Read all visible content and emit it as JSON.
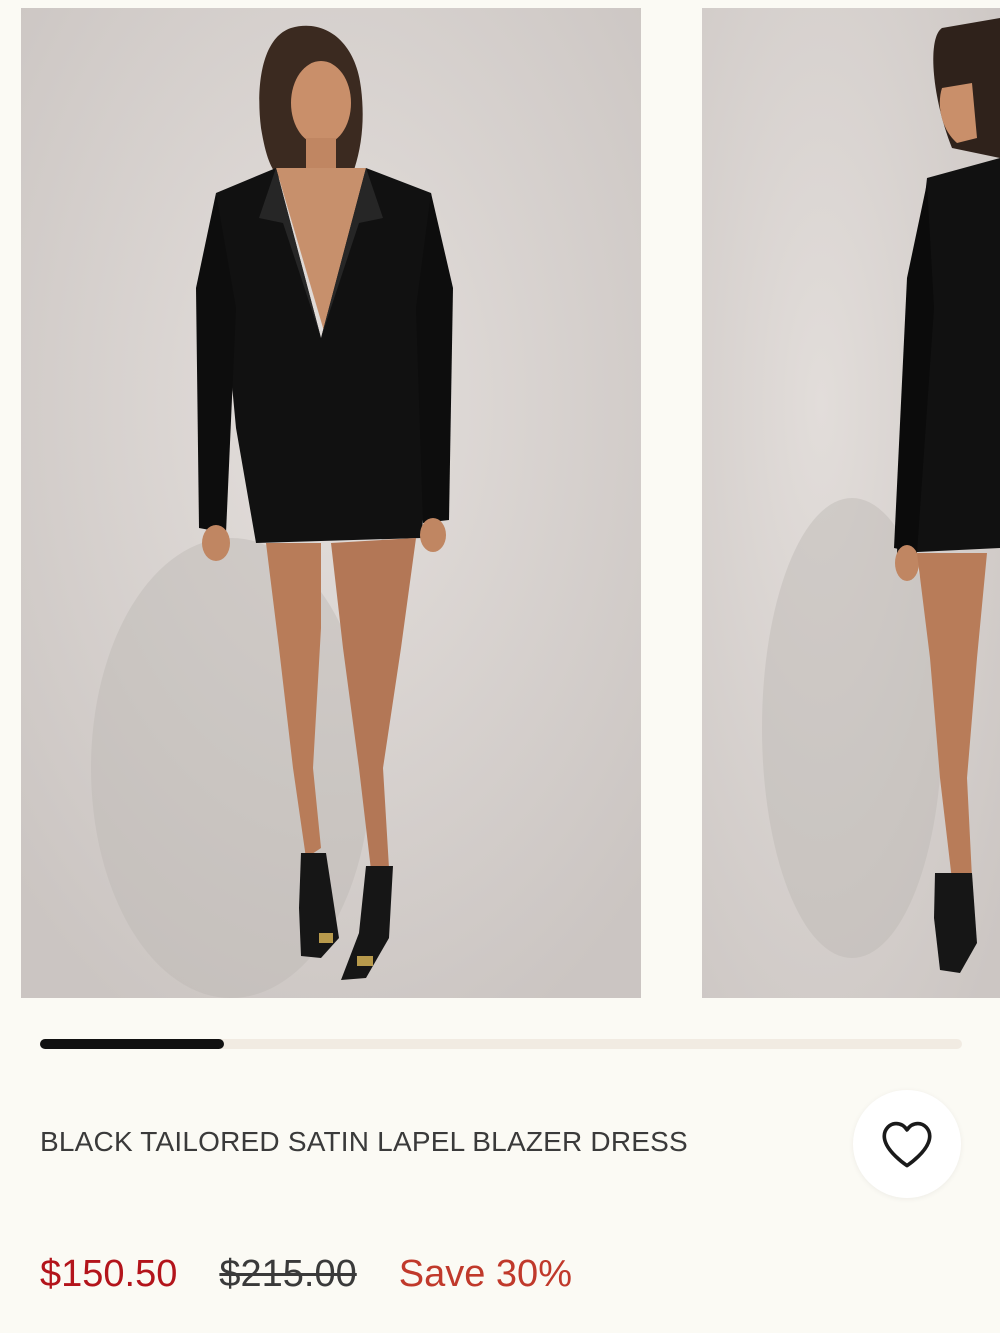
{
  "product": {
    "title": "BLACK TAILORED SATIN LAPEL BLAZER DRESS",
    "price_current": "$150.50",
    "price_original": "$215.00",
    "savings": "Save 30%"
  },
  "gallery": {
    "images": [
      {
        "alt": "Model front view in black satin lapel blazer dress"
      },
      {
        "alt": "Model side view in black satin lapel blazer dress"
      }
    ],
    "progress": 0.2
  },
  "icons": {
    "wishlist": "heart-icon"
  },
  "colors": {
    "background": "#fbfaf4",
    "sale_price": "#b3141b",
    "save_text": "#c0392b",
    "progress_fill": "#111111",
    "progress_track": "#f1ebe2"
  }
}
